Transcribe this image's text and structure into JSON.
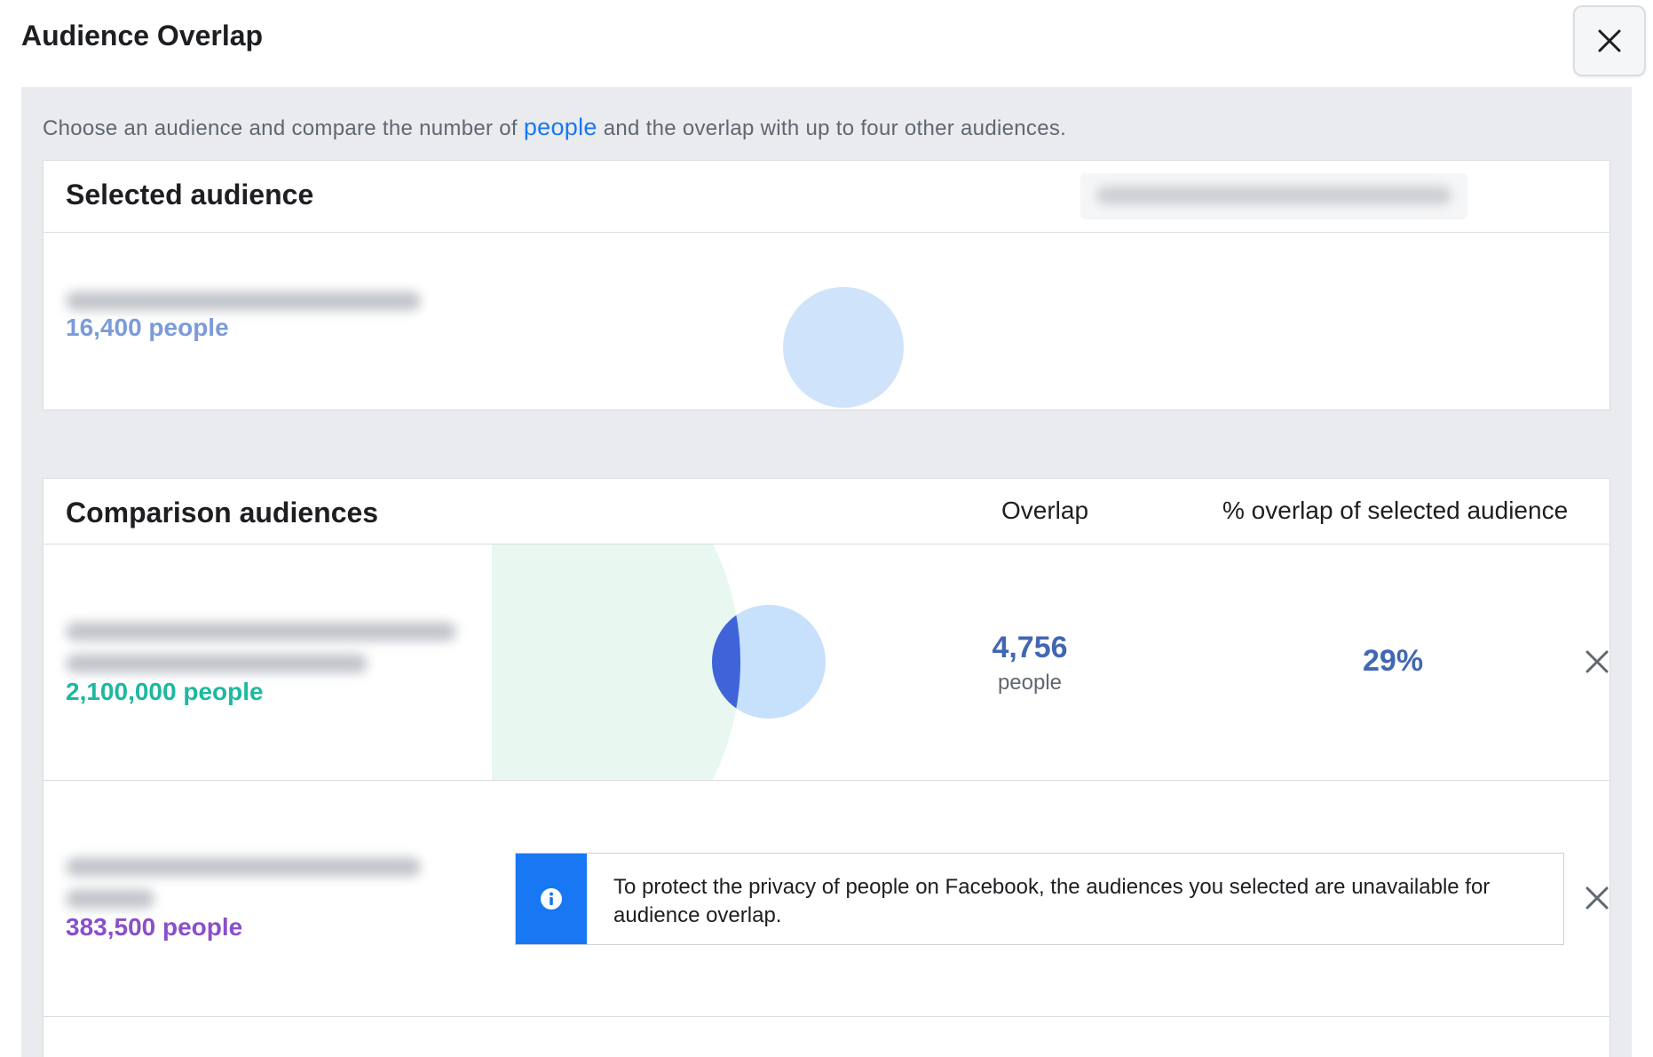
{
  "dialog": {
    "title": "Audience Overlap"
  },
  "intro": {
    "before": "Choose an audience and compare the number of ",
    "link": "people",
    "after": " and the overlap with up to four other audiences."
  },
  "selected": {
    "title": "Selected audience",
    "count": "16,400 people",
    "count_color": "#7b9bd9"
  },
  "comparison": {
    "title": "Comparison audiences",
    "overlap_header": "Overlap",
    "percent_header": "% overlap of selected audience",
    "rows": [
      {
        "count": "2,100,000 people",
        "count_color": "#1eb8a0",
        "overlap_value": "4,756",
        "overlap_unit": "people",
        "percent": "29%"
      },
      {
        "count": "383,500 people",
        "count_color": "#8a4fc9",
        "notice": "To protect the privacy of people on Facebook, the audiences you selected are unavailable for audience overlap."
      }
    ]
  },
  "colors": {
    "accent": "#4267b2",
    "link": "#1877f2",
    "selected_circle": "#cfe3fb",
    "comparison_area": "#e8f8f1",
    "overlap_fill": "#3f63d8"
  },
  "icons": {
    "close": "close-icon",
    "info": "info-icon"
  }
}
